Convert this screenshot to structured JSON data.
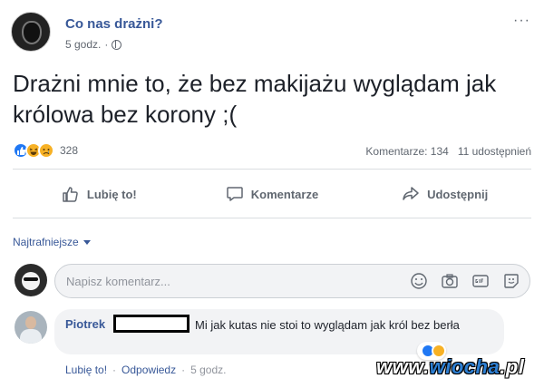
{
  "post": {
    "page_name": "Co nas drażni?",
    "time": "5 godz.",
    "privacy_icon": "globe-icon",
    "more_label": "···",
    "text": "Drażni mnie to, że bez makijażu wyglądam jak królowa bez korony ;(",
    "reactions": {
      "icons": [
        "like",
        "haha",
        "sad"
      ],
      "count": "328"
    },
    "comments_count": "Komentarze: 134",
    "shares_count": "11 udostępnień"
  },
  "actions": {
    "like_label": "Lubię to!",
    "comment_label": "Komentarze",
    "share_label": "Udostępnij"
  },
  "sort": {
    "label": "Najtrafniejsze"
  },
  "composer": {
    "placeholder": "Napisz komentarz...",
    "icons": [
      "emoji-icon",
      "camera-icon",
      "gif-icon",
      "sticker-icon"
    ]
  },
  "comment": {
    "author": "Piotrek",
    "text": "Mi jak kutas nie stoi to wyglądam jak król bez berła",
    "like_label": "Lubię to!",
    "reply_label": "Odpowiedz",
    "time": "5 godz.",
    "separator": "·"
  },
  "watermark": {
    "prefix": "www.",
    "brand": "wiocha",
    "suffix": ".pl"
  },
  "colors": {
    "link": "#385898",
    "muted": "#606770",
    "like": "#2078f4",
    "bubble": "#f2f3f5"
  }
}
